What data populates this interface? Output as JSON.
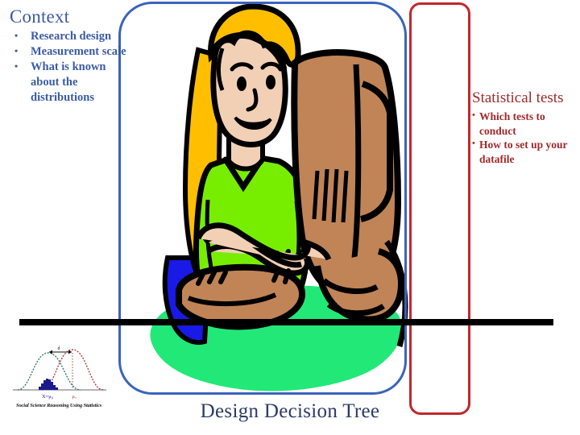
{
  "slide": {
    "caption": "Design Decision Tree",
    "background": "#ffffff"
  },
  "context_block": {
    "title": "Context",
    "color": "#3b5ba5",
    "bullets": [
      "Research design",
      "Measurement scale",
      "What is known about the distributions"
    ]
  },
  "statistics_block": {
    "title": "Statistical tests",
    "color": "#9e2a2b",
    "bullets": [
      "Which tests to conduct",
      "How to set up your datafile"
    ]
  },
  "shapes": {
    "blue_rounded_rect_color": "#3b63bd",
    "red_rounded_rect_color": "#c1272d",
    "divider_bar_color": "#000000"
  },
  "book_thumbnail": {
    "title": "Social Science Reasoning Using Statistics",
    "label_left": "X=μ₀",
    "label_right": "μₐ",
    "label_gap": "d",
    "curve_left_color": "#2f7d66",
    "curve_right_color": "#b0413e",
    "histogram_color": "#1a1a8c"
  },
  "clipart": {
    "name": "woman-at-computer",
    "hair_color": "#FFBF00",
    "skin_color": "#F2D0B5",
    "shirt_color": "#77EE00",
    "pants_color": "#1A1AE6",
    "computer_color": "#C08457",
    "floor_color": "#22E878",
    "outline_color": "#000000"
  }
}
